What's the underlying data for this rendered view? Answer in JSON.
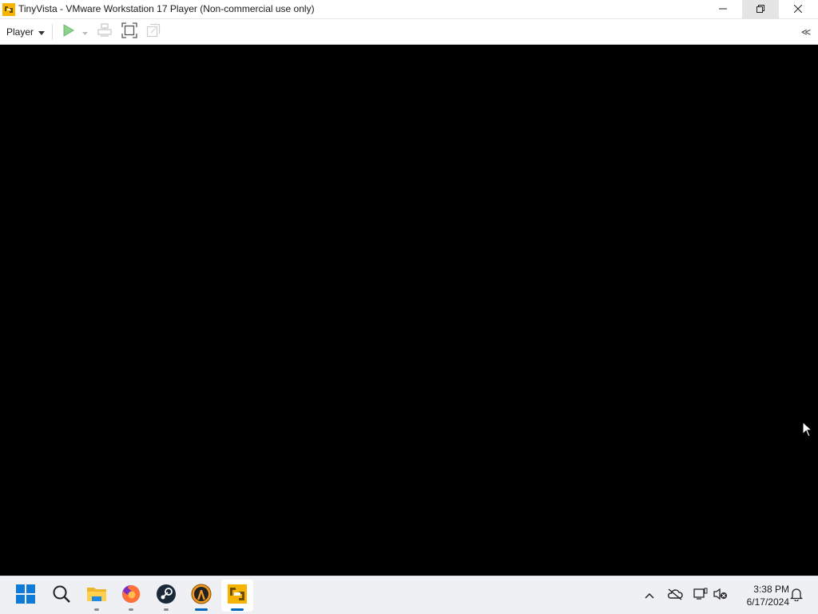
{
  "window": {
    "title": "TinyVista - VMware Workstation 17 Player (Non-commercial use only)",
    "icon": "vmware-logo-icon",
    "controls": {
      "minimize": "minimize-icon",
      "restore": "restore-icon",
      "close": "close-icon"
    }
  },
  "toolbar": {
    "player_label": "Player",
    "buttons": [
      {
        "name": "power-on",
        "icon": "play-icon",
        "color": "#7ec87e",
        "enabled": true
      },
      {
        "name": "power-dropdown",
        "icon": "chevron-down-icon",
        "enabled": false
      },
      {
        "name": "send-ctrl-alt-del",
        "icon": "ctrl-alt-del-icon",
        "enabled": false
      },
      {
        "name": "full-screen",
        "icon": "fullscreen-icon",
        "enabled": true
      },
      {
        "name": "unity",
        "icon": "unity-icon",
        "enabled": false
      }
    ],
    "collapse_label": "≪"
  },
  "vm": {
    "display_color": "#000000"
  },
  "taskbar": {
    "apps": [
      {
        "name": "start",
        "icon": "windows-start-icon"
      },
      {
        "name": "search",
        "icon": "search-icon"
      },
      {
        "name": "file-explorer",
        "icon": "folder-icon",
        "running": true
      },
      {
        "name": "firefox",
        "icon": "firefox-icon",
        "running": true
      },
      {
        "name": "steam",
        "icon": "steam-icon",
        "running": true
      },
      {
        "name": "half-life",
        "icon": "half-life-icon",
        "running": true
      },
      {
        "name": "vmware-player",
        "icon": "vmware-icon",
        "running": true,
        "active": true
      }
    ],
    "tray": {
      "icons": [
        "chevron-up-icon",
        "onedrive-offline-icon",
        "display-icon",
        "network-sound-muted-icon"
      ],
      "time": "3:38 PM",
      "date": "6/17/2024",
      "notification_icon": "bell-icon"
    },
    "accent": "#0067c0"
  }
}
